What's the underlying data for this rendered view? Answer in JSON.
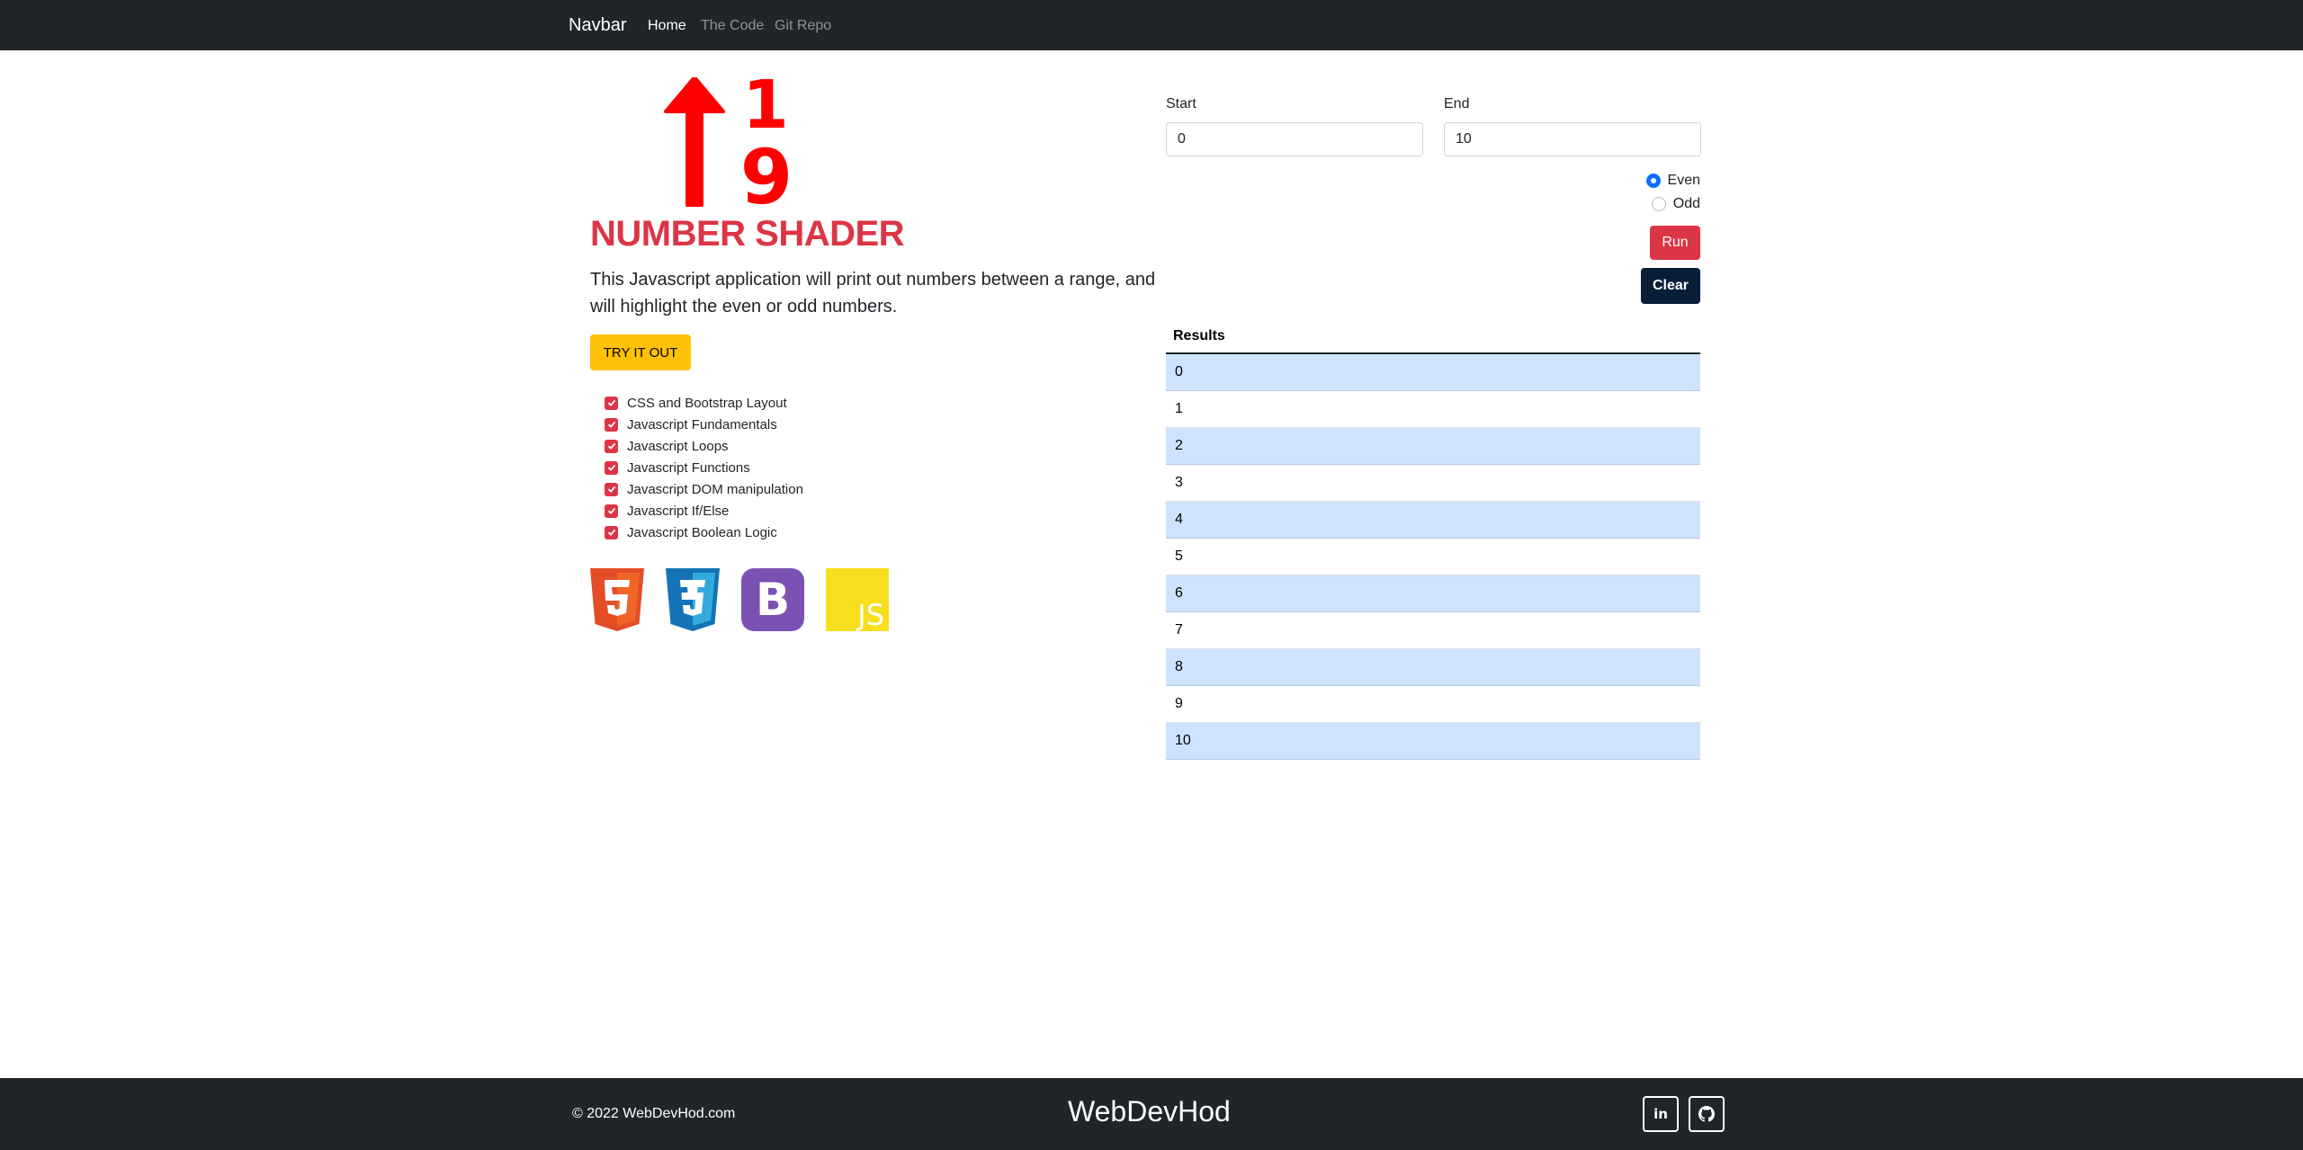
{
  "navbar": {
    "brand": "Navbar",
    "links": [
      {
        "label": "Home",
        "active": true
      },
      {
        "label": "The Code",
        "active": false
      },
      {
        "label": "Git Repo",
        "active": false
      }
    ]
  },
  "hero": {
    "logo_digits": [
      "1",
      "9"
    ],
    "title": "NUMBER SHADER",
    "description": "This Javascript application will print out numbers between a range, and will highlight the even or odd numbers.",
    "try_button": "TRY IT OUT",
    "skills": [
      "CSS and Bootstrap Layout",
      "Javascript Fundamentals",
      "Javascript Loops",
      "Javascript Functions",
      "Javascript DOM manipulation",
      "Javascript If/Else",
      "Javascript Boolean Logic"
    ],
    "tech_icons": [
      {
        "name": "html5-icon",
        "glyph": "5",
        "color": "#e44d26"
      },
      {
        "name": "css3-icon",
        "glyph": "3",
        "color": "#1572b6"
      },
      {
        "name": "bootstrap-icon",
        "glyph": "B",
        "color": "#7952b3"
      },
      {
        "name": "javascript-icon",
        "glyph": "JS",
        "color": "#f7df1e"
      }
    ]
  },
  "form": {
    "start_label": "Start",
    "start_value": "0",
    "end_label": "End",
    "end_value": "10",
    "radio_options": [
      {
        "label": "Even",
        "checked": true
      },
      {
        "label": "Odd",
        "checked": false
      }
    ],
    "run_button": "Run",
    "clear_button": "Clear"
  },
  "results": {
    "header": "Results",
    "rows": [
      {
        "value": "0",
        "highlighted": true
      },
      {
        "value": "1",
        "highlighted": false
      },
      {
        "value": "2",
        "highlighted": true
      },
      {
        "value": "3",
        "highlighted": false
      },
      {
        "value": "4",
        "highlighted": true
      },
      {
        "value": "5",
        "highlighted": false
      },
      {
        "value": "6",
        "highlighted": true
      },
      {
        "value": "7",
        "highlighted": false
      },
      {
        "value": "8",
        "highlighted": true
      },
      {
        "value": "9",
        "highlighted": false
      },
      {
        "value": "10",
        "highlighted": true
      }
    ]
  },
  "colors": {
    "accent_red": "#dc3545",
    "highlight_blue": "#cfe2ff",
    "dark": "#212529",
    "try_yellow": "#ffc107",
    "clear_navy": "#071d38"
  },
  "footer": {
    "copyright": "© 2022 WebDevHod.com",
    "brand": "WebDevHod",
    "social": [
      {
        "name": "linkedin-icon",
        "label": "in"
      },
      {
        "name": "github-icon",
        "label": ""
      }
    ]
  }
}
